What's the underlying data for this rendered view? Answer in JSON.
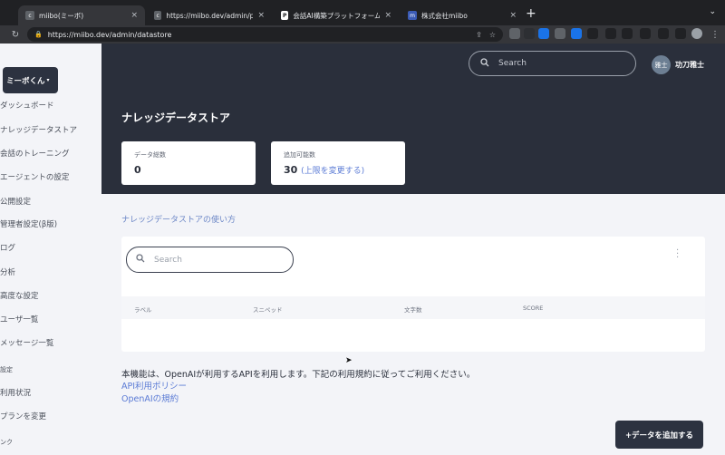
{
  "browser": {
    "tabs": [
      {
        "title": "miibo(ミーボ)",
        "icon": "c",
        "active": true
      },
      {
        "title": "https://miibo.dev/admin/previe",
        "icon": "c",
        "active": false
      },
      {
        "title": "会話AI構築プラットフォーム「mi",
        "icon": "P",
        "active": false
      },
      {
        "title": "株式会社miibo",
        "icon": "m",
        "active": false
      }
    ],
    "close_glyph": "×",
    "new_tab": "+",
    "url": "https://miibo.dev/admin/datastore"
  },
  "sidebar": {
    "brand_button": "ミーボくん",
    "items": [
      "ダッシュボード",
      "ナレッジデータストア",
      "会話のトレーニング",
      "エージェントの設定",
      "公開設定",
      "管理者設定(β版)",
      "ログ",
      "分析",
      "高度な設定",
      "ユーザ一覧",
      "メッセージ一覧"
    ],
    "section_settings": "設定",
    "settings_items": [
      "利用状況",
      "プランを変更"
    ],
    "section_links": "ンク"
  },
  "header": {
    "search_placeholder": "Search",
    "avatar_text": "雅士",
    "user_name": "功刀雅士",
    "page_title": "ナレッジデータストア"
  },
  "stats": {
    "total_label": "データ総数",
    "total_value": "0",
    "addable_label": "追加可能数",
    "addable_value": "30",
    "addable_link": "(上限を変更する)"
  },
  "main": {
    "howto_link": "ナレッジデータストアの使い方",
    "search_placeholder": "Search",
    "columns": [
      "ラベル",
      "スニペッド",
      "文字数",
      "SCORE"
    ],
    "notice": "本機能は、OpenAIが利用するAPIを利用します。下記の利用規約に従ってご利用ください。",
    "policy_links": [
      "API利用ポリシー",
      "OpenAIの規約"
    ],
    "add_button": "+データを追加する"
  },
  "colors": {
    "header_bg": "#2a2f3b",
    "button_dark": "#2c3240",
    "link": "#5b7bd5",
    "page_bg": "#f3f4f8"
  }
}
